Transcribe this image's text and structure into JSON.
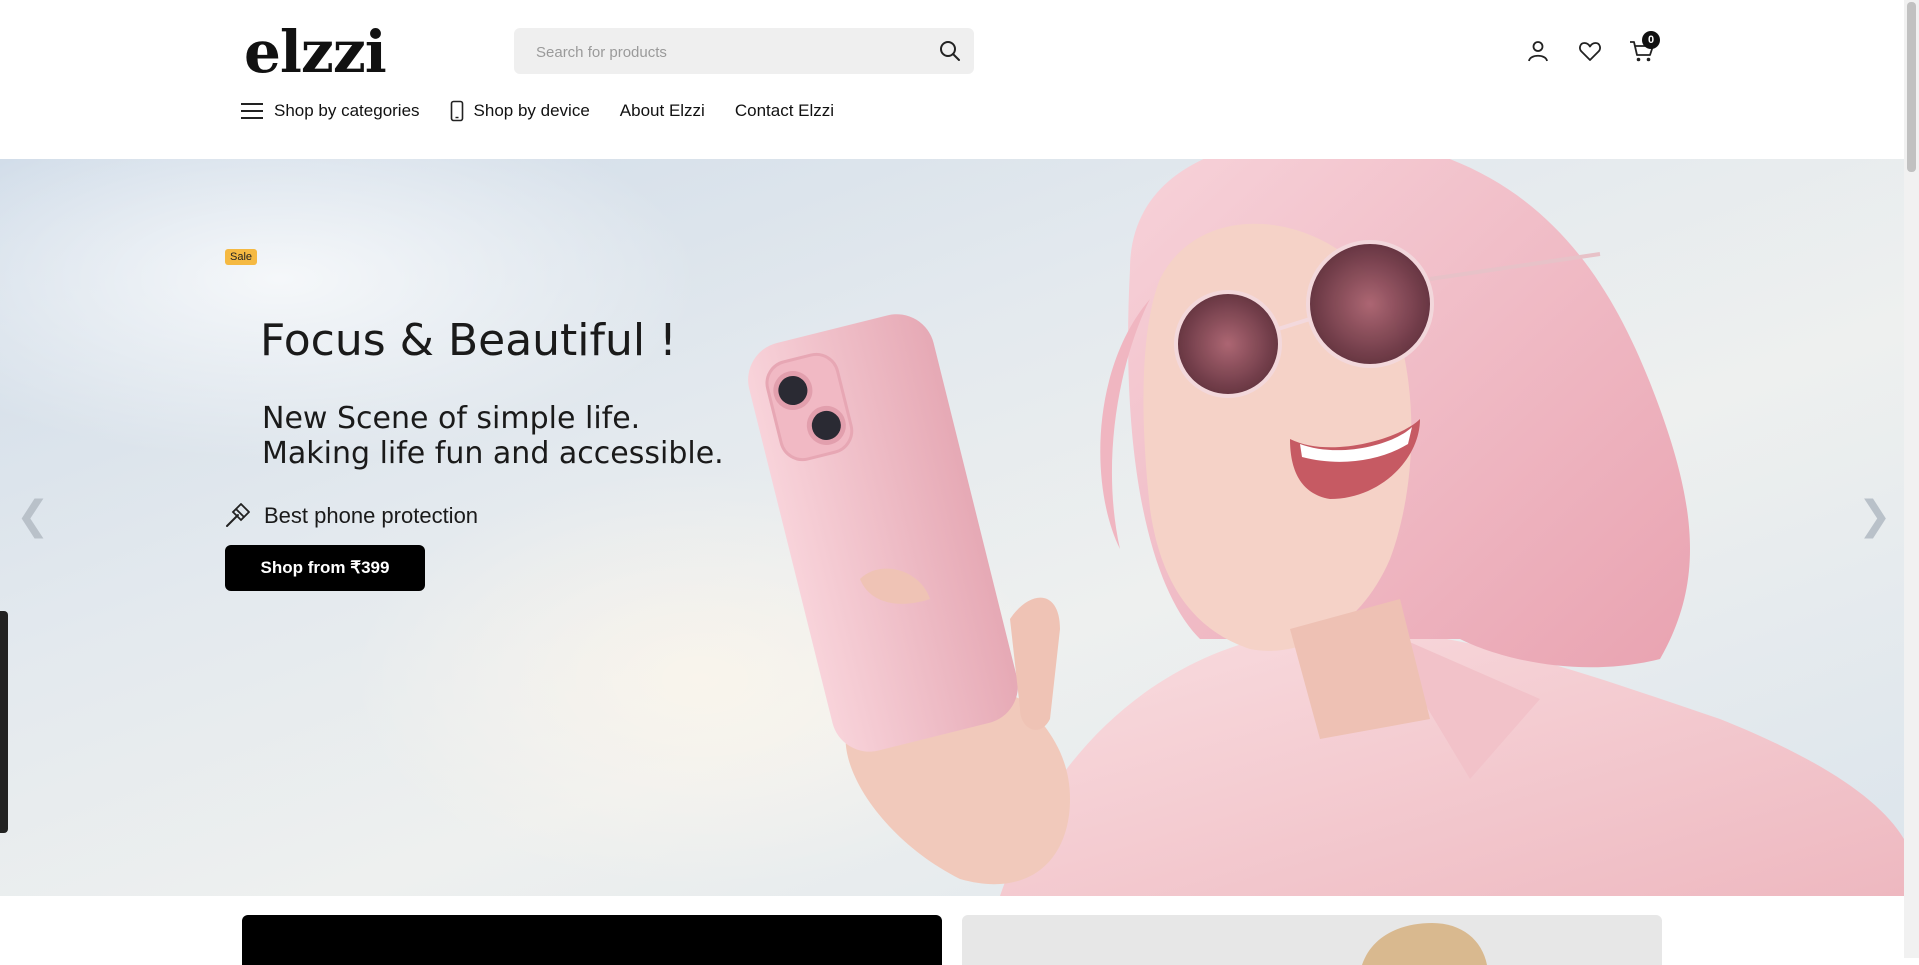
{
  "brand": {
    "logo_text": "elzzi"
  },
  "search": {
    "placeholder": "Search for products",
    "value": ""
  },
  "header_icons": [
    "user-icon",
    "heart-icon",
    "cart-icon"
  ],
  "cart": {
    "count": "0"
  },
  "nav": {
    "items": [
      {
        "label": "Shop by categories",
        "icon": "hamburger-icon"
      },
      {
        "label": "Shop by device",
        "icon": "phone-icon"
      },
      {
        "label": "About Elzzi"
      },
      {
        "label": "Contact Elzzi"
      }
    ]
  },
  "hero": {
    "badge": "Sale",
    "title": "Focus & Beautiful !",
    "subtitle_line1": "New Scene of simple life.",
    "subtitle_line2": "Making life fun and accessible.",
    "feature": "Best phone protection",
    "cta": "Shop from ₹399",
    "prev_arrow": "❮",
    "next_arrow": "❯"
  },
  "colors": {
    "accent": "#000000",
    "badge": "#f5b942",
    "phone_case": "#f4c7cf",
    "hair": "#f2b9c4",
    "shirt": "#f6cfd4"
  }
}
